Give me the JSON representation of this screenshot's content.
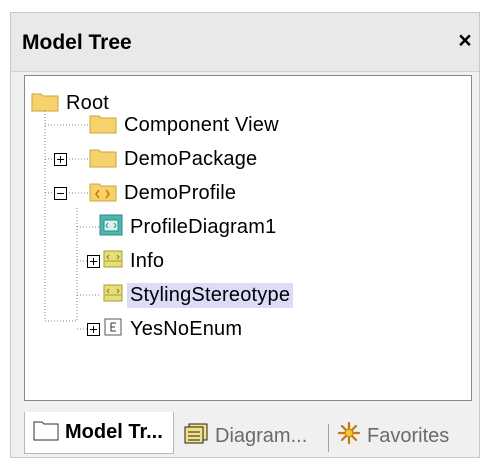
{
  "panel": {
    "title": "Model Tree",
    "close_glyph": "×"
  },
  "tree": {
    "nodes": [
      {
        "label": "Root",
        "icon": "folder-icon",
        "expander": "none"
      },
      {
        "label": "Component View",
        "icon": "folder-icon",
        "expander": "none"
      },
      {
        "label": "DemoPackage",
        "icon": "folder-icon",
        "expander": "plus"
      },
      {
        "label": "DemoProfile",
        "icon": "profile-folder-icon",
        "expander": "minus"
      },
      {
        "label": "ProfileDiagram1",
        "icon": "profile-diagram-icon",
        "expander": "none"
      },
      {
        "label": "Info",
        "icon": "stereotype-icon",
        "expander": "plus"
      },
      {
        "label": "StylingStereotype",
        "icon": "stereotype-icon",
        "expander": "none",
        "selected": true
      },
      {
        "label": "YesNoEnum",
        "icon": "enumeration-icon",
        "expander": "plus"
      }
    ]
  },
  "tabs": [
    {
      "label": "Model Tr...",
      "icon": "folder-icon",
      "active": true
    },
    {
      "label": "Diagram...",
      "icon": "diagram-tree-icon",
      "active": false
    },
    {
      "label": "Favorites",
      "icon": "favorites-icon",
      "active": false
    }
  ],
  "colors": {
    "folder": "#f7d26c",
    "diagram": "#4bb8b0",
    "stereotype": "#d7d05a",
    "selection": "#dcdcf8"
  }
}
